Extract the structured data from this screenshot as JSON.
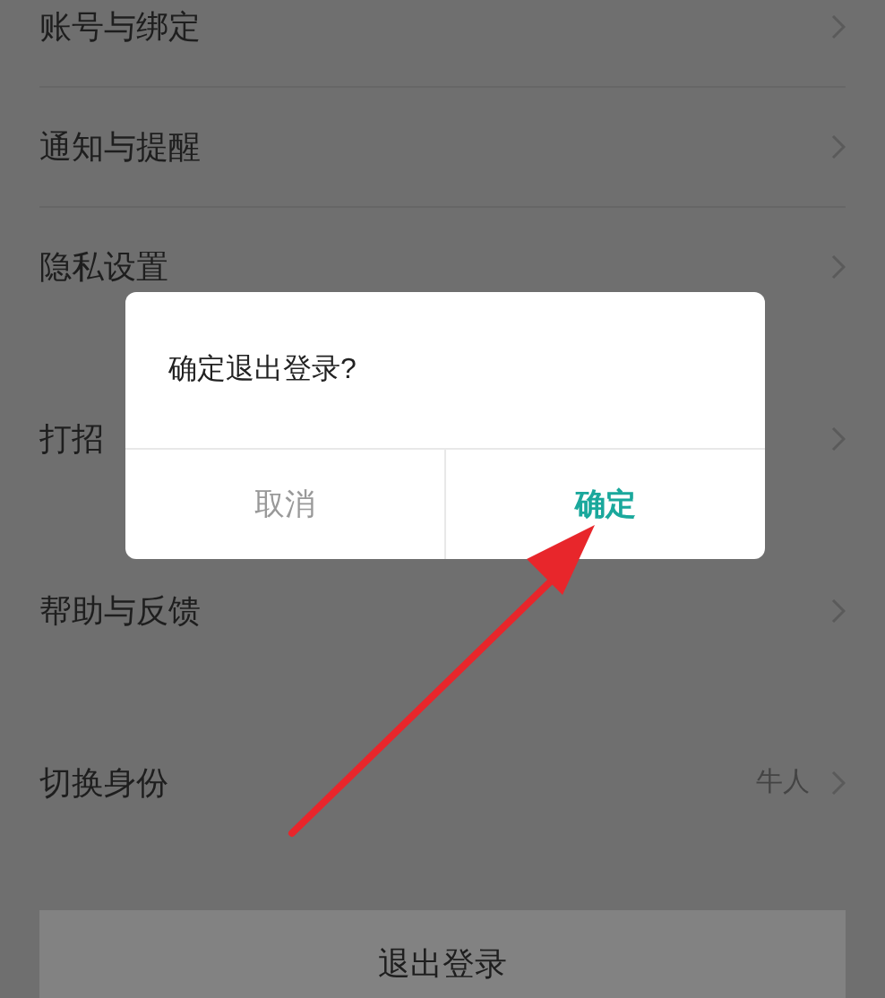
{
  "sections": [
    {
      "rows": [
        {
          "label": "账号与绑定"
        },
        {
          "label": "通知与提醒"
        },
        {
          "label": "隐私设置"
        }
      ]
    },
    {
      "rows": [
        {
          "label": "打招"
        }
      ]
    },
    {
      "rows": [
        {
          "label": "帮助与反馈"
        }
      ]
    },
    {
      "rows": [
        {
          "label": "切换身份",
          "value": "牛人"
        }
      ]
    }
  ],
  "logout_button": "退出登录",
  "dialog": {
    "title": "确定退出登录?",
    "buttons": [
      {
        "label": "取消",
        "kind": "cancel"
      },
      {
        "label": "确定",
        "kind": "confirm"
      }
    ]
  }
}
